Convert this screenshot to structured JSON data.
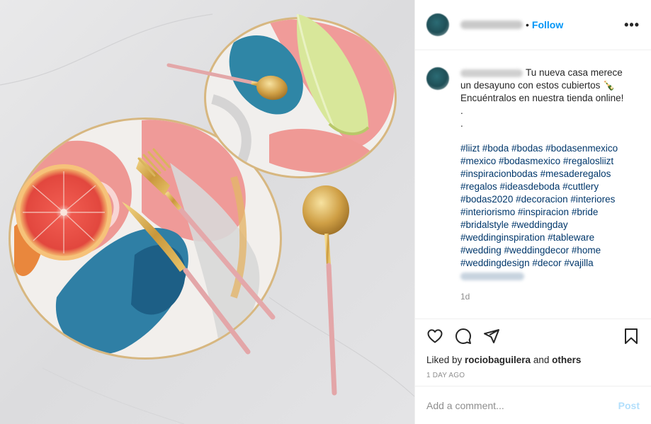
{
  "post": {
    "follow_label": "Follow",
    "dot": "•",
    "more_icon": "more-options-icon",
    "caption": {
      "line1": "Tu nueva casa merece",
      "line2": "un desayuno con estos cubiertos 🍾",
      "line3": "Encuéntralos en nuestra tienda online!",
      "dot1": ".",
      "dot2": ".",
      "hashtags": "#liizt #boda #bodas #bodasenmexico\n#mexico #bodasmexico #regalosliizt\n#inspiracionbodas #mesaderegalos\n#regalos #ideasdeboda #cuttlery\n#bodas2020 #decoracion #interiores\n#interiorismo #inspiracion #bride\n#bridalstyle #weddingday\n#weddinginspiration #tableware\n#wedding #weddingdecor #home\n#weddingdesign #decor #vajilla"
    },
    "time_ago": "1d",
    "likes": {
      "prefix": "Liked by ",
      "user": "rociobaguilera",
      "middle": " and ",
      "others": "others"
    },
    "date": "1 DAY AGO",
    "comment": {
      "placeholder": "Add a comment...",
      "post_label": "Post"
    },
    "icons": [
      "heart-icon",
      "comment-icon",
      "share-icon",
      "bookmark-icon"
    ],
    "colors": {
      "link_blue": "#0095f6",
      "hashtag_blue": "#00376b",
      "muted": "#8e8e8e",
      "post_disabled": "#b2dffc"
    }
  }
}
